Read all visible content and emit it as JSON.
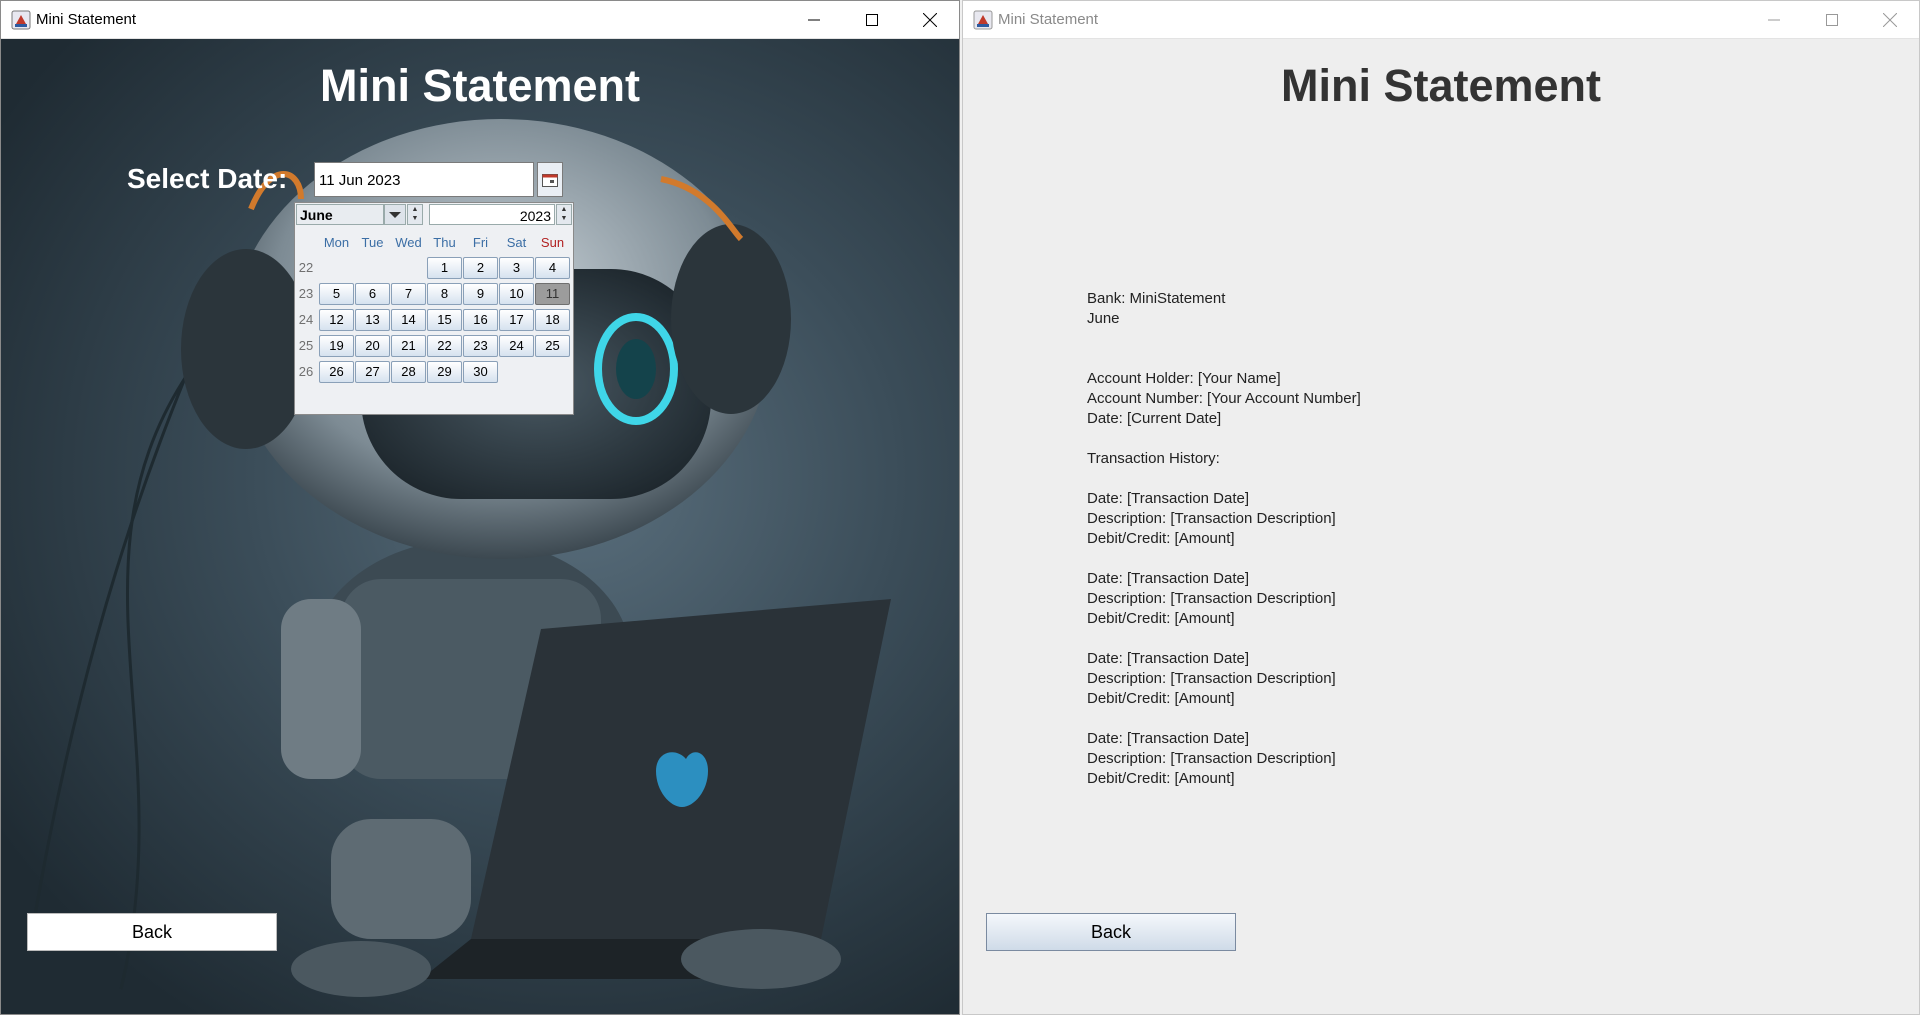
{
  "colors": {
    "left_heading": "#ffffff",
    "right_heading": "#333333",
    "sunday": "#b22222",
    "weekday": "#3b6ea5"
  },
  "left_window": {
    "title": "Mini Statement",
    "heading": "Mini Statement",
    "select_label": "Select Date:",
    "date_value": "11 Jun 2023",
    "back_label": "Back"
  },
  "calendar": {
    "month": "June",
    "year": "2023",
    "weekdays": [
      "Mon",
      "Tue",
      "Wed",
      "Thu",
      "Fri",
      "Sat",
      "Sun"
    ],
    "weeks": [
      "22",
      "23",
      "24",
      "25",
      "26"
    ],
    "days": [
      [
        "",
        "",
        "",
        "1",
        "2",
        "3",
        "4"
      ],
      [
        "5",
        "6",
        "7",
        "8",
        "9",
        "10",
        "11"
      ],
      [
        "12",
        "13",
        "14",
        "15",
        "16",
        "17",
        "18"
      ],
      [
        "19",
        "20",
        "21",
        "22",
        "23",
        "24",
        "25"
      ],
      [
        "26",
        "27",
        "28",
        "29",
        "30",
        "",
        ""
      ]
    ],
    "selected_day": "11"
  },
  "right_window": {
    "title": "Mini Statement",
    "heading": "Mini Statement",
    "back_label": "Back",
    "statement_lines": [
      "Bank: MiniStatement",
      "June",
      "",
      "",
      "Account Holder: [Your Name]",
      "Account Number: [Your Account Number]",
      "Date: [Current Date]",
      "",
      "Transaction History:",
      "",
      "Date: [Transaction Date]",
      "Description: [Transaction Description]",
      "Debit/Credit: [Amount]",
      "",
      "Date: [Transaction Date]",
      "Description: [Transaction Description]",
      "Debit/Credit: [Amount]",
      "",
      "Date: [Transaction Date]",
      "Description: [Transaction Description]",
      "Debit/Credit: [Amount]",
      "",
      "Date: [Transaction Date]",
      "Description: [Transaction Description]",
      "Debit/Credit: [Amount]"
    ]
  }
}
